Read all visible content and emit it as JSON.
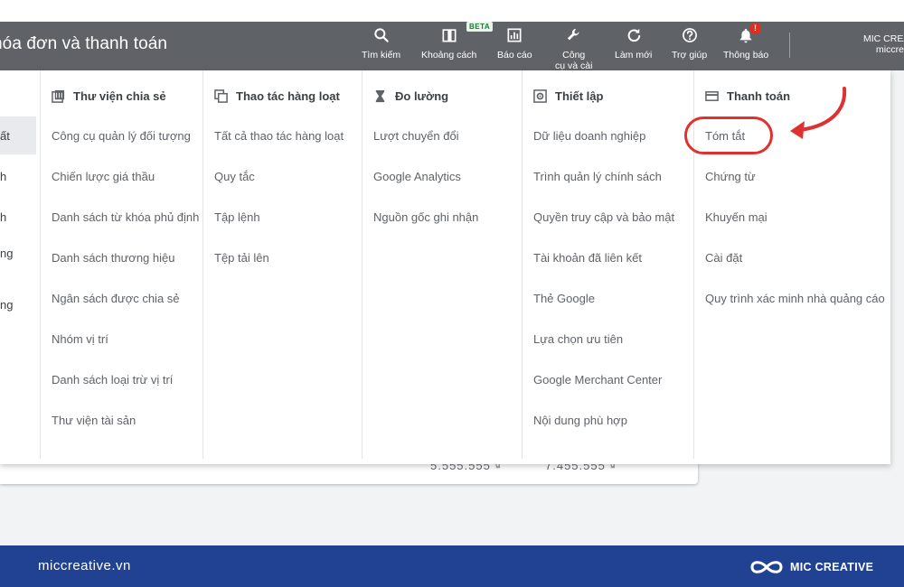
{
  "header": {
    "title": "hóa đơn và thanh toán",
    "toolbar": [
      {
        "label": "Tìm kiếm",
        "icon": "search-icon"
      },
      {
        "label": "Khoảng cách",
        "icon": "columns-icon"
      },
      {
        "label": "Báo cáo",
        "icon": "report-icon"
      },
      {
        "label": "Công cụ và cài",
        "icon": "wrench-icon"
      },
      {
        "label": "Làm mới",
        "icon": "refresh-icon"
      },
      {
        "label": "Trợ giúp",
        "icon": "help-icon"
      },
      {
        "label": "Thông báo",
        "icon": "bell-icon"
      }
    ],
    "tools_label_line1": "Công",
    "tools_label_line2": "cụ và cài",
    "beta_badge": "BETA",
    "notification_badge": "!",
    "account_name": "MIC CREA",
    "account_sub": "miccre"
  },
  "left_menu": [
    "ất",
    "h",
    "h",
    "ng",
    "ng"
  ],
  "menu": {
    "columns": [
      {
        "heading": "Thư viện chia sẻ",
        "icon": "library-icon",
        "items": [
          "Công cụ quản lý đối tượng",
          "Chiến lược giá thầu",
          "Danh sách từ khóa phủ định",
          "Danh sách thương hiệu",
          "Ngân sách được chia sẻ",
          "Nhóm vị trí",
          "Danh sách loại trừ vị trí",
          "Thư viện tài sản"
        ]
      },
      {
        "heading": "Thao tác hàng loạt",
        "icon": "copy-icon",
        "items": [
          "Tất cả thao tác hàng loạt",
          "Quy tắc",
          "Tập lệnh",
          "Tệp tải lên"
        ]
      },
      {
        "heading": "Đo lường",
        "icon": "hourglass-icon",
        "items": [
          "Lượt chuyển đổi",
          "Google Analytics",
          "Nguồn gốc ghi nhận"
        ]
      },
      {
        "heading": "Thiết lập",
        "icon": "settings-box-icon",
        "items": [
          "Dữ liệu doanh nghiệp",
          "Trình quản lý chính sách",
          "Quyền truy cập và bảo mật",
          "Tài khoản đã liên kết",
          "Thẻ Google",
          "Lựa chọn ưu tiên",
          "Google Merchant Center",
          "Nội dung phù hợp"
        ]
      },
      {
        "heading": "Thanh toán",
        "icon": "credit-card-icon",
        "items": [
          "Tóm tắt",
          "Chứng từ",
          "Khuyến mại",
          "Cài đặt",
          "Quy trình xác minh nhà quảng cáo"
        ]
      }
    ]
  },
  "background_values": [
    "5.555.555 ₫",
    "7.455.555 ₫"
  ],
  "footer": {
    "site": "miccreative.vn",
    "brand": "MIC CREATIVE"
  },
  "colors": {
    "topbar": "#5f6368",
    "footer": "#214192",
    "annotation": "#e03131"
  }
}
